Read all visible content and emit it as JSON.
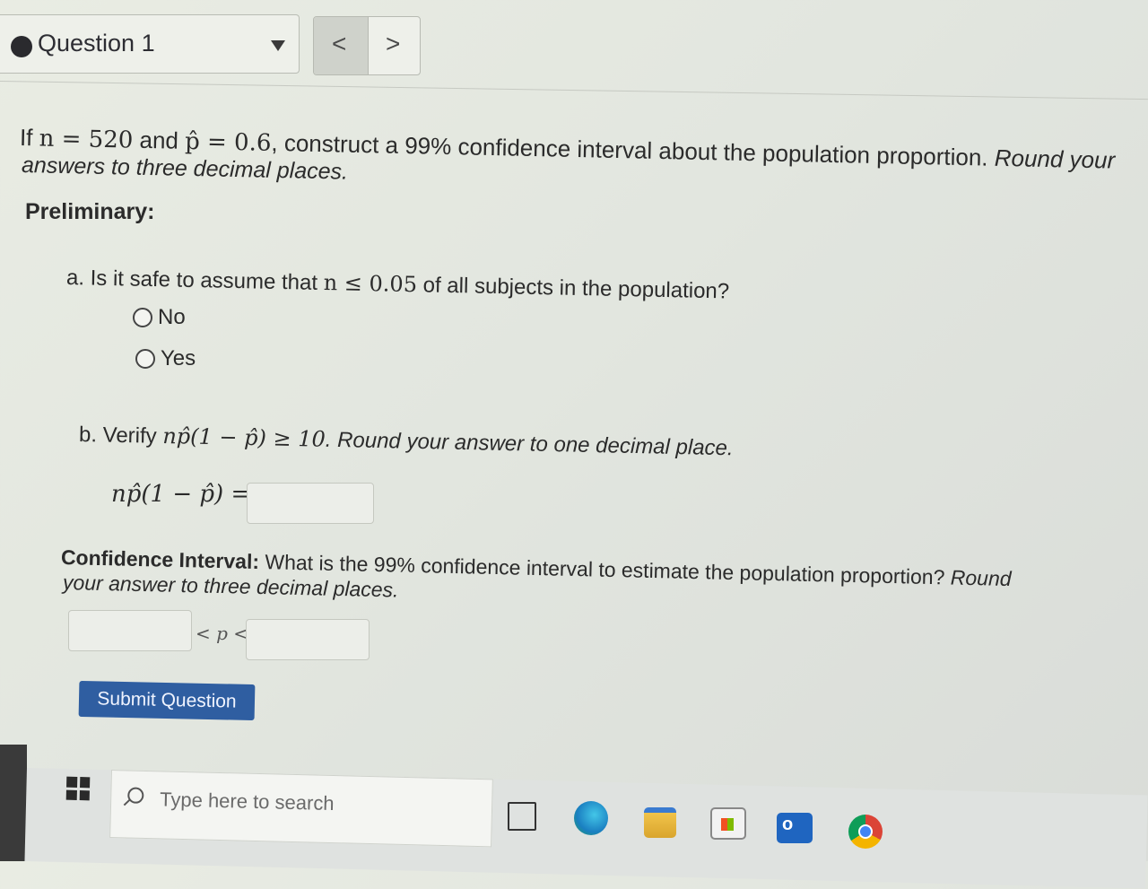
{
  "question_selector": {
    "label": "Question 1"
  },
  "nav": {
    "prev": "<",
    "next": ">"
  },
  "problem": {
    "prefix": "If ",
    "n_expr": "n = 520",
    "and": " and ",
    "p_expr": "p̂ = 0.6",
    "rest": ", construct a 99% confidence interval about the population proportion. ",
    "round_note_a": "Round your",
    "round_note_b": "answers to three decimal places."
  },
  "preliminary_label": "Preliminary:",
  "part_a": {
    "prompt_start": "a. Is it safe to assume that ",
    "prompt_math": "n ≤ 0.05",
    "prompt_end": " of all subjects in the population?",
    "options": [
      "No",
      "Yes"
    ]
  },
  "part_b": {
    "prompt_start": "b. Verify ",
    "prompt_math": "np̂(1 − p̂) ≥ 10",
    "prompt_end": ". Round your answer to one decimal place.",
    "equation_label": "np̂(1 − p̂) ="
  },
  "confidence_interval": {
    "heading": "Confidence Interval:",
    "question": " What is the 99% confidence interval to estimate the population proportion? ",
    "round_a": "Round",
    "round_b": "your answer to three decimal places.",
    "inequality": "< p <"
  },
  "submit_label": "Submit Question",
  "taskbar": {
    "search_placeholder": "Type here to search"
  }
}
